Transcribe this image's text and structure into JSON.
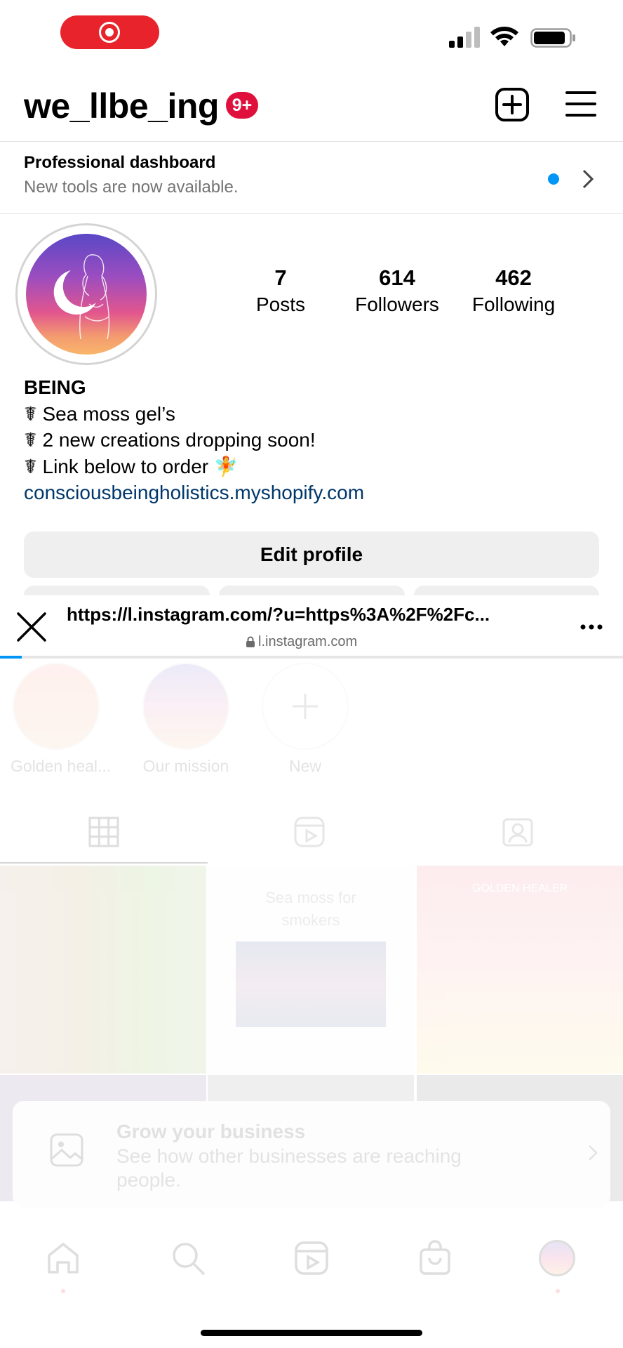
{
  "status_bar": {
    "recording_indicator": "screen-recording",
    "signal_icon": "cellular-signal-icon",
    "wifi_icon": "wifi-icon",
    "battery_icon": "battery-icon"
  },
  "header": {
    "username": "we_llbe_ing",
    "notification_badge": "9+",
    "new_post_icon": "plus-square-icon",
    "menu_icon": "hamburger-menu-icon",
    "badge_color": "#e0103c"
  },
  "dashboard": {
    "title": "Professional dashboard",
    "subtitle": "New tools are now available.",
    "dot_color": "#0095f6"
  },
  "profile": {
    "stats": [
      {
        "value": "7",
        "label": "Posts"
      },
      {
        "value": "614",
        "label": "Followers"
      },
      {
        "value": "462",
        "label": "Following"
      }
    ],
    "name": "BEING",
    "bio_lines": [
      "☤ Sea moss gel’s",
      "☤ 2 new creations dropping soon!",
      "☤ Link below to order 🧚"
    ],
    "link": "consciousbeingholistics.myshopify.com",
    "edit_button": "Edit profile",
    "link_color": "#00376b"
  },
  "browser": {
    "url": "https://l.instagram.com/?u=https%3A%2F%2Fc...",
    "domain": "l.instagram.com",
    "close_icon": "close-icon",
    "more_icon": "more-options-icon",
    "load_progress": 0.035,
    "progress_color": "#0095f6"
  },
  "background": {
    "highlights": [
      {
        "label": "Golden heal..."
      },
      {
        "label": "Our mission"
      },
      {
        "label": "New"
      }
    ],
    "post_texts": {
      "sea_moss": "Sea moss for smokers",
      "golden_healer": "GOLDEN HEALER"
    },
    "grow_card": {
      "title": "Grow your business",
      "subtitle": "See how other businesses are reaching people."
    },
    "nav_icons": [
      "home-icon",
      "search-icon",
      "reels-icon",
      "shop-icon",
      "profile-avatar"
    ]
  }
}
